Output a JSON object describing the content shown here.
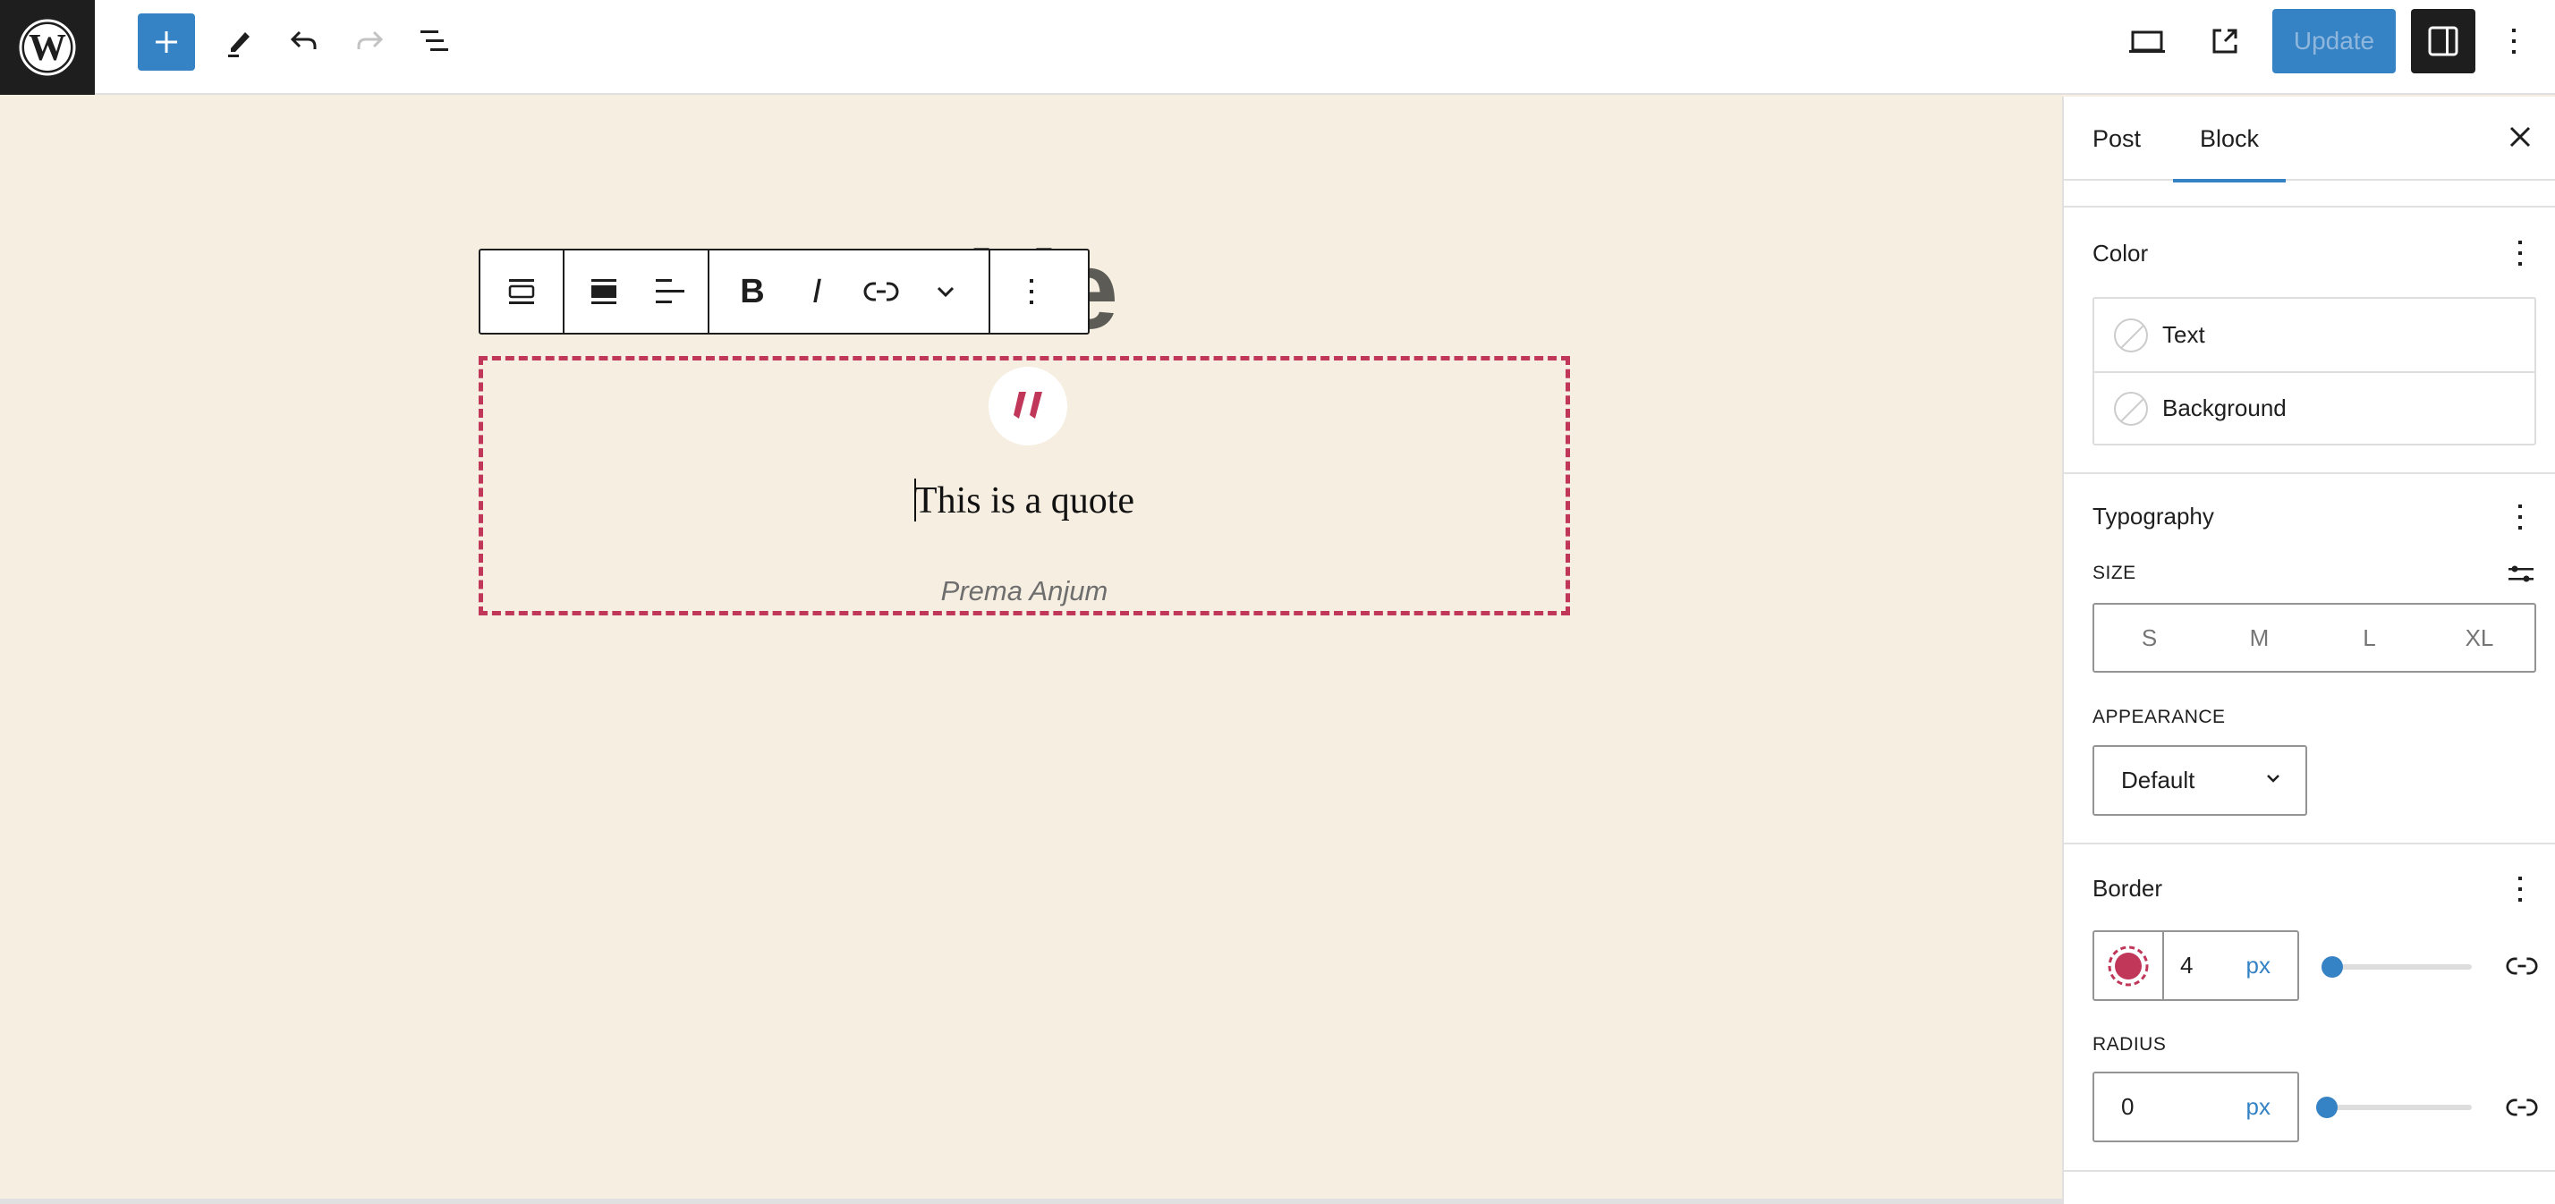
{
  "topbar": {
    "logo": "wordpress-logo",
    "add_block_icon": "plus-icon",
    "tools_icon": "pencil-icon",
    "undo_icon": "undo-icon",
    "redo_icon": "redo-icon",
    "list_view_icon": "list-view-icon",
    "view_icon": "laptop-icon",
    "preview_icon": "external-link-icon",
    "update_label": "Update",
    "settings_icon": "sidebar-toggle-icon",
    "options_icon": "more-vertical-icon"
  },
  "editor": {
    "post_title_visible": "itle",
    "block_toolbar": {
      "buttons": [
        "block-type",
        "align",
        "text-align",
        "bold",
        "italic",
        "link",
        "more-rich-text",
        "options"
      ],
      "bold_label": "B",
      "italic_label": "I"
    },
    "quote": {
      "text": "This is a quote",
      "citation": "Prema Anjum",
      "border_color": "#c0375a",
      "border_style": "dashed"
    }
  },
  "sidebar": {
    "tabs": [
      {
        "label": "Post",
        "active": false
      },
      {
        "label": "Block",
        "active": true
      }
    ],
    "color": {
      "title": "Color",
      "items": [
        {
          "label": "Text"
        },
        {
          "label": "Background"
        }
      ]
    },
    "typography": {
      "title": "Typography",
      "size_label": "SIZE",
      "size_options": [
        "S",
        "M",
        "L",
        "XL"
      ],
      "appearance_label": "APPEARANCE",
      "appearance_value": "Default"
    },
    "border": {
      "title": "Border",
      "color": "#c0375a",
      "width_value": "4",
      "width_unit": "px",
      "width_slider_fraction": 0.0,
      "radius_label": "RADIUS",
      "radius_value": "0",
      "radius_unit": "px",
      "radius_slider_fraction": 0.0
    }
  },
  "colors": {
    "accent": "#3582c4",
    "canvas": "#f5eee1",
    "dark": "#1e1e1e"
  }
}
